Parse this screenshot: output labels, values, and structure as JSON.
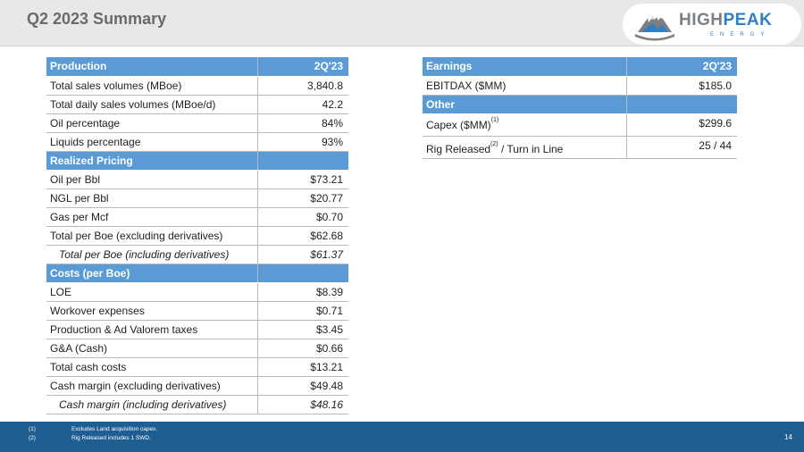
{
  "slide": {
    "title": "Q2 2023 Summary",
    "page_number": "14"
  },
  "logo": {
    "word_part1": "HIGH",
    "word_part2": "PEAK",
    "subword": "ENERGY",
    "colors": {
      "gray": "#7c7f84",
      "blue": "#2f7fc4"
    }
  },
  "left_table": {
    "rows": [
      {
        "type": "header",
        "label": "Production",
        "value": "2Q'23"
      },
      {
        "type": "data",
        "label": "Total sales volumes (MBoe)",
        "value": "3,840.8"
      },
      {
        "type": "data",
        "label": "Total daily sales volumes (MBoe/d)",
        "value": "42.2"
      },
      {
        "type": "data",
        "label": "Oil percentage",
        "value": "84%"
      },
      {
        "type": "data",
        "label": "Liquids percentage",
        "value": "93%"
      },
      {
        "type": "section",
        "label": "Realized Pricing",
        "value": ""
      },
      {
        "type": "data",
        "label": "Oil per Bbl",
        "value": "$73.21"
      },
      {
        "type": "data",
        "label": "NGL per Bbl",
        "value": "$20.77"
      },
      {
        "type": "data",
        "label": "Gas per Mcf",
        "value": "$0.70"
      },
      {
        "type": "data",
        "label": "Total per Boe (excluding derivatives)",
        "value": "$62.68"
      },
      {
        "type": "italic",
        "label": "Total per Boe (including derivatives)",
        "value": "$61.37"
      },
      {
        "type": "section",
        "label": "Costs (per Boe)",
        "value": ""
      },
      {
        "type": "data",
        "label": "LOE",
        "value": "$8.39"
      },
      {
        "type": "data",
        "label": "Workover expenses",
        "value": "$0.71"
      },
      {
        "type": "data",
        "label": "Production & Ad Valorem taxes",
        "value": "$3.45"
      },
      {
        "type": "data",
        "label": "G&A (Cash)",
        "value": "$0.66"
      },
      {
        "type": "data",
        "label": "Total cash costs",
        "value": "$13.21"
      },
      {
        "type": "data",
        "label": "Cash margin (excluding derivatives)",
        "value": "$49.48"
      },
      {
        "type": "italic",
        "label": "Cash margin (including derivatives)",
        "value": "$48.16"
      }
    ]
  },
  "right_table": {
    "earnings_header": "Earnings",
    "period_header": "2Q'23",
    "ebitdax_label": "EBITDAX ($MM)",
    "ebitdax_value": "$185.0",
    "other_header": "Other",
    "capex_label": "Capex ($MM)",
    "capex_note": "(1)",
    "capex_value": "$299.6",
    "rig_label_a": "Rig Released",
    "rig_note": "(2)",
    "rig_label_b": "/ Turn in Line",
    "rig_value": "25 / 44"
  },
  "footnotes": [
    {
      "num": "(1)",
      "text": "Excludes Land acquisition capex."
    },
    {
      "num": "(2)",
      "text": "Rig Released includes 1 SWD."
    }
  ],
  "theme": {
    "header_blue": "#5b9bd5",
    "footer_blue": "#1f5e93",
    "title_gray": "#6a6a6a"
  }
}
